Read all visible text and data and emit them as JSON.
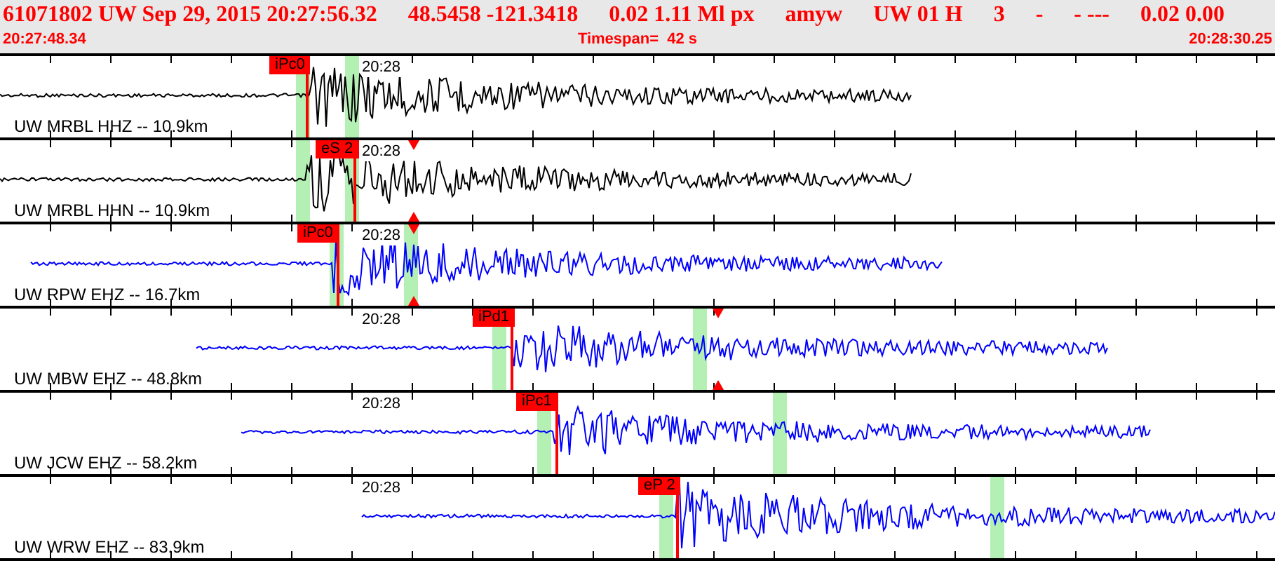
{
  "header": {
    "fields": [
      "61071802 UW Sep 29, 2015 20:27:56.32",
      "48.5458 -121.3418",
      "0.02 1.11 Ml px",
      "amyw",
      "UW 01 H",
      "3",
      "-",
      "- ---",
      "0.02 0.00"
    ],
    "start_time": "20:27:48.34",
    "timespan": "Timespan=  42 s",
    "end_time": "20:28:30.25"
  },
  "channels": [
    {
      "label": "UW MRBL HHZ -- 10.9km",
      "pick": "iPc0",
      "time_mark": "20:28",
      "color": "#000000"
    },
    {
      "label": "UW MRBL HHN -- 10.9km",
      "pick": "eS 2",
      "time_mark": "20:28",
      "color": "#000000"
    },
    {
      "label": "UW RPW EHZ -- 16.7km",
      "pick": "iPc0",
      "time_mark": "20:28",
      "color": "#0000ff"
    },
    {
      "label": "UW MBW EHZ -- 48.8km",
      "pick": "iPd1",
      "time_mark": "20:28",
      "color": "#0000ff"
    },
    {
      "label": "UW JCW EHZ -- 58.2km",
      "pick": "iPc1",
      "time_mark": "20:28",
      "color": "#0000ff"
    },
    {
      "label": "UW WRW EHZ -- 83.9km",
      "pick": "eP 2",
      "time_mark": "20:28",
      "color": "#0000ff"
    }
  ]
}
